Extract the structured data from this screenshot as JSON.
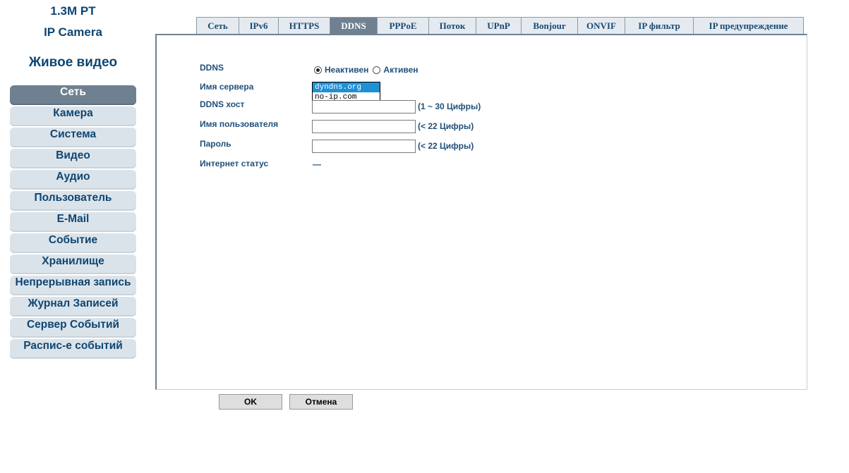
{
  "brand": {
    "model": "1.3M PT",
    "product": "IP Camera"
  },
  "live_video": "Живое видео",
  "sidebar": {
    "active_index": 0,
    "items": [
      {
        "label": "Сеть"
      },
      {
        "label": "Камера"
      },
      {
        "label": "Система"
      },
      {
        "label": "Видео"
      },
      {
        "label": "Аудио"
      },
      {
        "label": "Пользователь"
      },
      {
        "label": "E-Mail"
      },
      {
        "label": "Событие"
      },
      {
        "label": "Хранилище"
      },
      {
        "label": "Непрерывная запись"
      },
      {
        "label": "Журнал Записей"
      },
      {
        "label": "Сервер Событий"
      },
      {
        "label": "Распис-е событий"
      }
    ]
  },
  "tabs": {
    "active": "DDNS",
    "items": [
      {
        "label": "Сеть"
      },
      {
        "label": "IPv6"
      },
      {
        "label": "HTTPS"
      },
      {
        "label": "DDNS"
      },
      {
        "label": "PPPoE"
      },
      {
        "label": "Поток"
      },
      {
        "label": "UPnP"
      },
      {
        "label": "Bonjour"
      },
      {
        "label": "ONVIF"
      },
      {
        "label": "IP фильтр"
      },
      {
        "label": "IP предупреждение"
      }
    ]
  },
  "form": {
    "ddns": {
      "label": "DDNS",
      "options": [
        "Неактивен",
        "Активен"
      ],
      "selected": "Неактивен"
    },
    "server_name": {
      "label": "Имя сервера",
      "options": [
        "dyndns.org",
        "no-ip.com"
      ],
      "selected": "dyndns.org"
    },
    "ddns_host": {
      "label": "DDNS хост",
      "value": "",
      "hint": "(1 ~ 30 Цифры)"
    },
    "username": {
      "label": "Имя пользователя",
      "value": "",
      "hint": "(< 22 Цифры)"
    },
    "password": {
      "label": "Пароль",
      "value": "",
      "hint": "(< 22 Цифры)"
    },
    "internet_status": {
      "label": "Интернет статус",
      "value": "—"
    }
  },
  "buttons": {
    "ok": "OK",
    "cancel": "Отмена"
  },
  "colors": {
    "accent": "#6f8191",
    "text": "#1f4f7a",
    "nav_bg": "#dbe3ea",
    "highlight": "#1e90d6"
  }
}
